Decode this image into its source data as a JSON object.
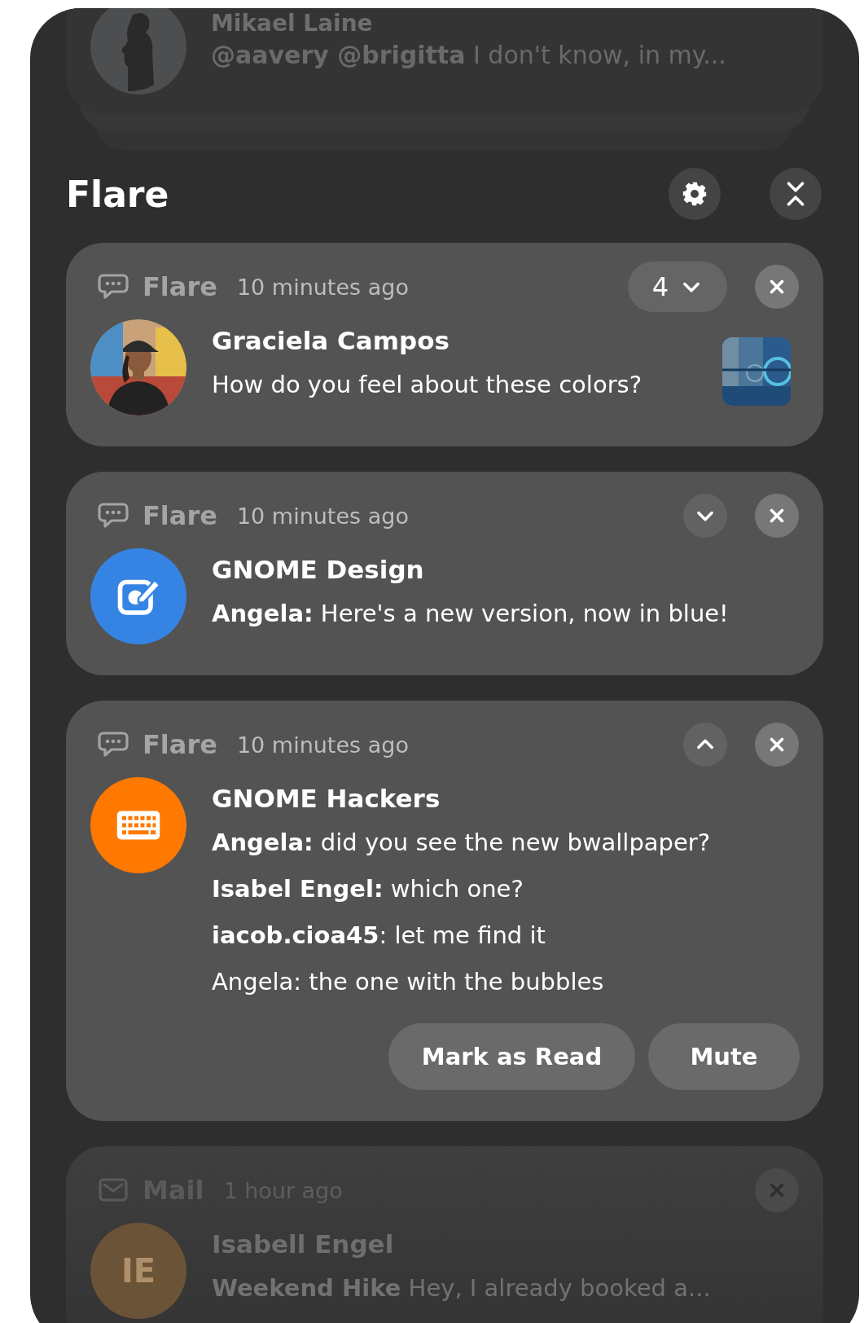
{
  "stacked": {
    "title": "Mikael Laine",
    "body": "**@aavery @brigitta** I don't know, in my..."
  },
  "header": {
    "title": "Flare"
  },
  "notifications": [
    {
      "app": "Flare",
      "kind": "chat",
      "time": "10 minutes ago",
      "count": "4",
      "expanded": false,
      "dimmed": false,
      "title": "Graciela Campos",
      "lines": [
        "How do you feel about these colors?"
      ]
    },
    {
      "app": "Flare",
      "kind": "chat",
      "time": "10 minutes ago",
      "expanded": false,
      "dimmed": false,
      "avatar": {
        "kind": "edit",
        "color": "#3584e4"
      },
      "title": "GNOME Design",
      "lines": [
        "**Angela:** Here's a new version, now in blue!"
      ]
    },
    {
      "app": "Flare",
      "kind": "chat",
      "time": "10 minutes ago",
      "expanded": true,
      "dimmed": false,
      "avatar": {
        "kind": "keyboard",
        "color": "#ff7800"
      },
      "title": "GNOME Hackers",
      "lines": [
        "**Angela:** did you see the new bwallpaper?",
        "**Isabel Engel:** which one?",
        "**iacob.cioa45**: let me find it",
        "Angela: the one with the bubbles"
      ],
      "actions": [
        "Mark as Read",
        "Mute"
      ]
    },
    {
      "app": "Mail",
      "kind": "mail",
      "time": "1 hour ago",
      "dimmed": true,
      "avatar": {
        "kind": "initials",
        "text": "IE",
        "color": "#6b5337"
      },
      "title": "Isabell Engel",
      "lines": [
        "**Weekend Hike** Hey, I already booked a..."
      ]
    }
  ]
}
